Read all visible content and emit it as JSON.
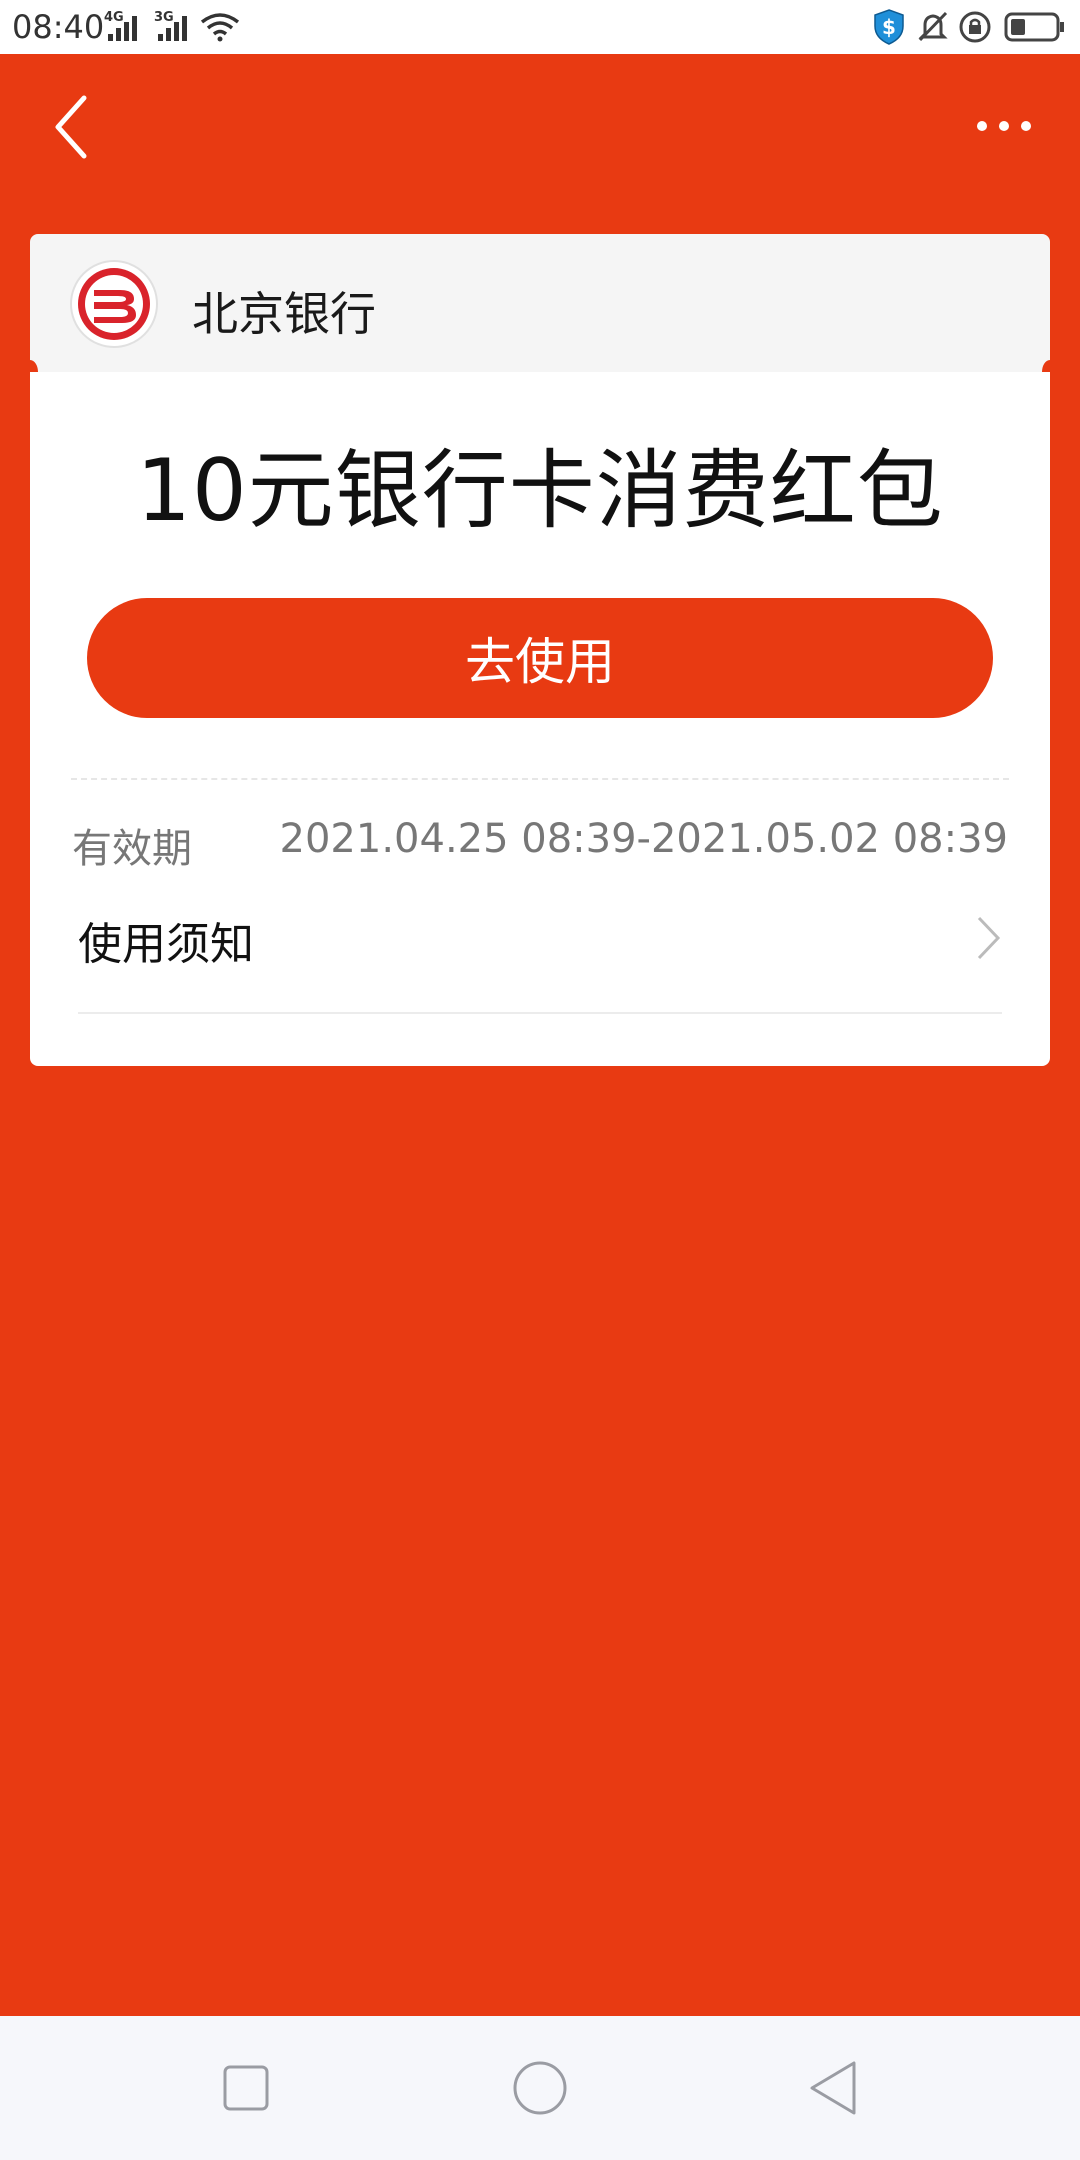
{
  "status_bar": {
    "time": "08:40",
    "signal_1_label": "4G",
    "signal_2_label": "3G",
    "icons": [
      "wifi-icon",
      "shield-dollar-icon",
      "bell-off-icon",
      "rotation-lock-icon",
      "battery-icon"
    ],
    "shield_color": "#1f8fd9"
  },
  "nav": {
    "back_icon": "chevron-left-icon",
    "more_icon": "more-dots-icon"
  },
  "card": {
    "bank_name": "北京银行",
    "bank_logo_color": "#d9232b",
    "title": "10元银行卡消费红包",
    "use_button_label": "去使用",
    "validity_label": "有效期",
    "validity_value": "2021.04.25 08:39-2021.05.02 08:39",
    "notice_label": "使用须知"
  },
  "theme": {
    "accent": "#e83a12"
  },
  "system_nav": {
    "icons": [
      "recent-apps-icon",
      "home-icon",
      "back-triangle-icon"
    ]
  }
}
